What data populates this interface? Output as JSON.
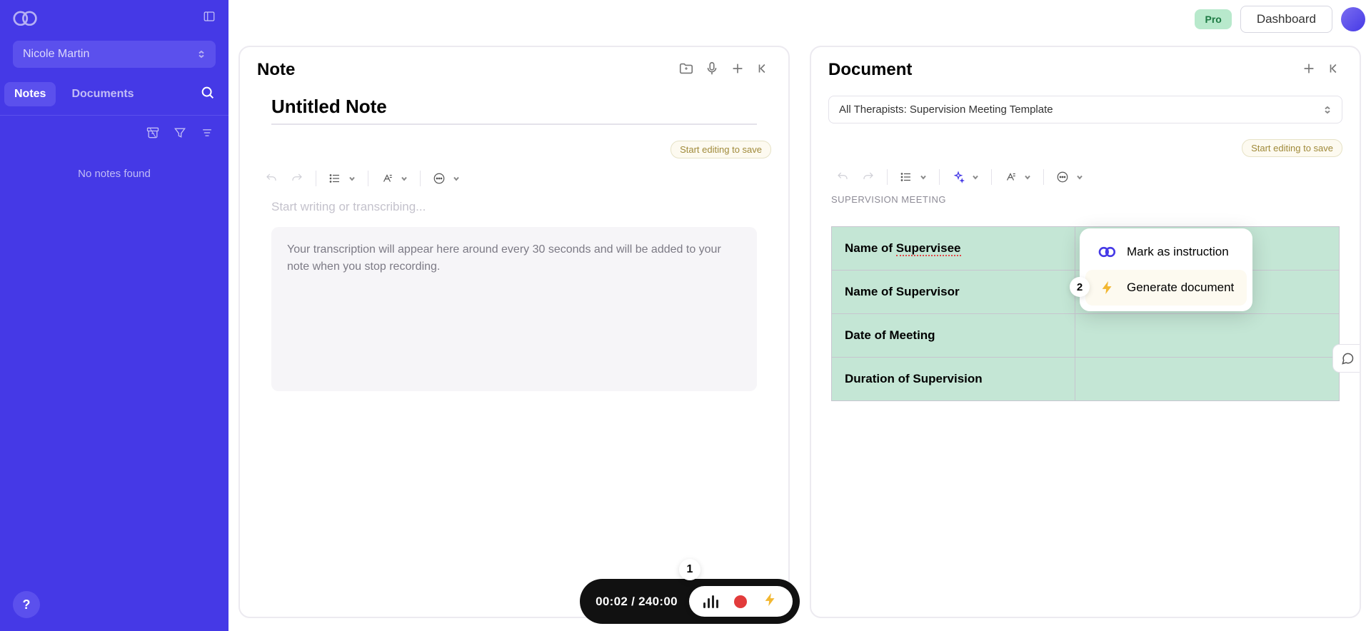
{
  "sidebar": {
    "patient": "Nicole Martin",
    "tabs": {
      "notes": "Notes",
      "documents": "Documents"
    },
    "empty": "No notes found",
    "help": "?"
  },
  "topbar": {
    "pro": "Pro",
    "dashboard": "Dashboard"
  },
  "note_panel": {
    "title": "Note",
    "note_title": "Untitled Note",
    "save_hint": "Start editing to save",
    "placeholder": "Start writing or transcribing...",
    "transcription_hint": "Your transcription will appear here around every 30 seconds and will be added to your note when you stop recording."
  },
  "doc_panel": {
    "title": "Document",
    "template": "All Therapists: Supervision Meeting Template",
    "save_hint": "Start editing to save",
    "section_label": "SUPERVISION MEETING",
    "rows": [
      {
        "label_pre": "Name of ",
        "label_u": "Supervisee"
      },
      {
        "label": "Name of Supervisor"
      },
      {
        "label": "Date of Meeting"
      },
      {
        "label": "Duration of Supervision"
      }
    ]
  },
  "popup": {
    "badge": "2",
    "item1": "Mark as instruction",
    "item2": "Generate document"
  },
  "recorder": {
    "badge": "1",
    "time": "00:02 / 240:00"
  }
}
